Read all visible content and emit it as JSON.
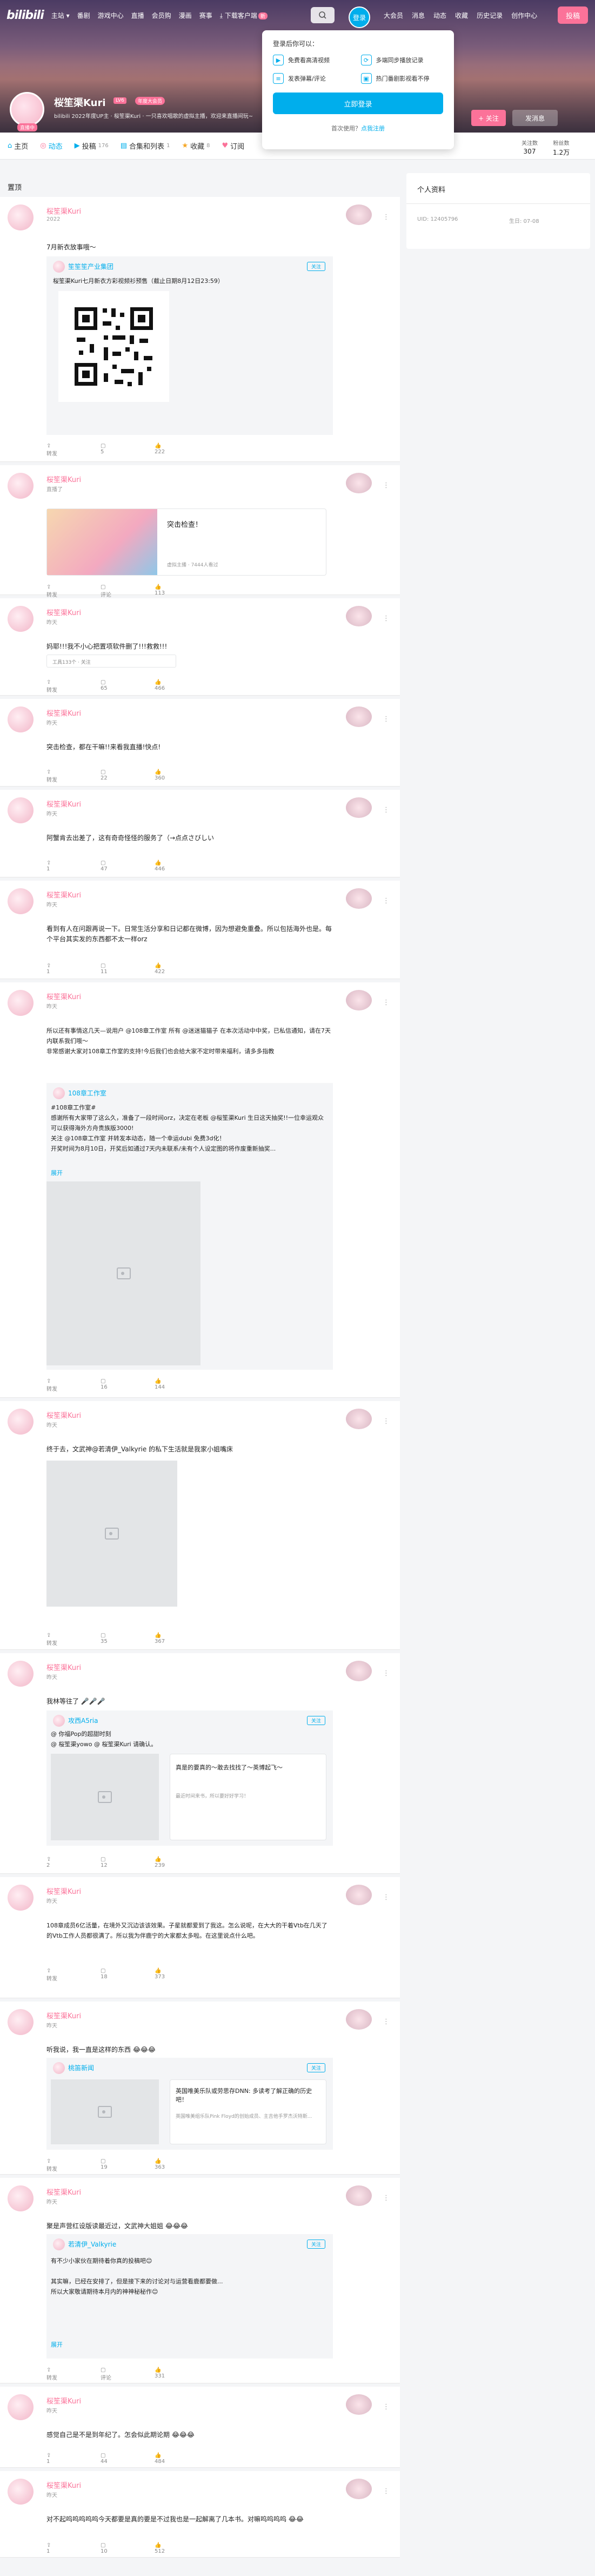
{
  "header": {
    "logo": "bilibili",
    "nav": [
      "主站",
      "番剧",
      "游戏中心",
      "直播",
      "会员购",
      "漫画",
      "赛事"
    ],
    "download": "下载客户端",
    "download_badge": "新",
    "login": "登录",
    "right_nav": [
      "大会员",
      "消息",
      "动态",
      "收藏",
      "历史记录",
      "创作中心"
    ],
    "post": "投稿"
  },
  "login_popup": {
    "title": "登录后你可以：",
    "items": [
      "免费看高清视频",
      "多端同步播放记录",
      "发表弹幕/评论",
      "热门番剧影视看不停"
    ],
    "button": "立即登录",
    "register_prefix": "首次使用？",
    "register_link": "点我注册"
  },
  "profile": {
    "name": "桜笙渠Kuri",
    "lv": "LV6",
    "vip": "年度大会员",
    "live_tag": "直播中",
    "sign": "bilibili 2022年度UP主 · 桜笙渠Kuri · 一只喜欢唱歌的虚拟主播，欢迎来直播间玩~",
    "follow": "+ 关注",
    "message": "发消息"
  },
  "tabs": [
    {
      "label": "主页",
      "icon": "home-icon",
      "count": ""
    },
    {
      "label": "动态",
      "icon": "feed-icon",
      "count": ""
    },
    {
      "label": "投稿",
      "icon": "upload-icon",
      "count": "176"
    },
    {
      "label": "合集和列表",
      "icon": "list-icon",
      "count": "1"
    },
    {
      "label": "收藏",
      "icon": "star-icon",
      "count": "8"
    },
    {
      "label": "订阅",
      "icon": "heart-icon",
      "count": ""
    }
  ],
  "stats": [
    {
      "label": "关注数",
      "value": "307"
    },
    {
      "label": "粉丝数",
      "value": "1.2万"
    }
  ],
  "section_label": "置顶",
  "sidebar": {
    "title": "个人资料",
    "uid": "UID: 12405796",
    "birthday": "生日: 07-08"
  },
  "posts": [
    {
      "name": "桜笙渠Kuri",
      "time": "2022",
      "text": "7月新衣放事哦～",
      "sub_name": "笙笙笙产业集团",
      "sub_text": "桜笙渠Kuri七月新衣方彩视频衫预售（截止日期8月12日23:59）",
      "follow": "关注",
      "actions": [
        "转发",
        "5",
        "222"
      ]
    },
    {
      "name": "桜笙渠Kuri",
      "time": "直播了",
      "live_title": "突击检查！",
      "live_meta": "虚拟主播 · 7444人看过",
      "actions": [
        "转发",
        "评论",
        "113"
      ]
    },
    {
      "name": "桜笙渠Kuri",
      "time": "昨天",
      "text": "妈耶!!!我不小心把置项软件删了!!!救救!!!",
      "sub_text": "工具133个 · 关注",
      "actions": [
        "转发",
        "65",
        "466"
      ]
    },
    {
      "name": "桜笙渠Kuri",
      "time": "昨天",
      "text": "突击检查，都在干嘛!!来看我直播!快点!",
      "actions": [
        "转发",
        "22",
        "360"
      ]
    },
    {
      "name": "桜笙渠Kuri",
      "time": "昨天",
      "text": "阿蟹肯去出差了，这有奇奇怪怪的服务了（→点点さびしい",
      "actions": [
        "1",
        "47",
        "446"
      ]
    },
    {
      "name": "桜笙渠Kuri",
      "time": "昨天",
      "text": "看到有人在问跟再说一下。日常生活分享和日记都在微博，因为想避免重叠。所以包括海外也是。每个平台其实发的东西都不太一样orz",
      "actions": [
        "1",
        "11",
        "422"
      ]
    },
    {
      "name": "桜笙渠Kuri",
      "time": "昨天",
      "text": "所以还有事情这几天—说用户 @108章工作室 所有 @迷迷猫猫子 在本次活动中中奖，已私信通知，请在7天内联系我们哦～\n非常感谢大家对108章工作室的支持!今后我们也会给大家不定时带来福利，请多多指教",
      "sub_name": "108章工作室",
      "sub_text": "#108章工作室#\n感谢所有大家带了这么久，准备了一段时间orz，决定在老板 @桜笙渠Kuri 生日这天抽奖!!一位幸运观众可以获得海外方舟贵族版3000!\n关注 @108章工作室 并转发本动态，随一个幸运dubi 免费3d化！\n开奖时间为8月10日，开奖后如通过7天内未联系/未有个人设定图的将作废重新抽奖...",
      "expand": "展开",
      "actions": [
        "转发",
        "16",
        "144"
      ]
    },
    {
      "name": "桜笙渠Kuri",
      "time": "昨天",
      "text": "终于去，文武神@若清伊_Valkyrie 的私下生活就是我家小姐嘴床",
      "actions": [
        "转发",
        "35",
        "367"
      ]
    },
    {
      "name": "桜笙渠Kuri",
      "time": "昨天",
      "text": "我林等往了 🎤🎤🎤",
      "sub_name": "攻西A5ria",
      "sub_text": "@ 你福Pop的超甜时刻\n@ 桜笙渠yowo @ 桜笙渠Kuri 请确认。",
      "link_title": "真是的要真的～敢去找找了～英博起飞～",
      "link_desc": "最近时间来书，所以要好好学习！",
      "follow": "关注",
      "actions": [
        "2",
        "12",
        "239"
      ]
    },
    {
      "name": "桜笙渠Kuri",
      "time": "昨天",
      "text": "108章成员6亿活量，在境外又沉边该该效果。子星就都爱到了我这。怎么说呢，在大大的干着Vtb在几天了的Vtb工作人员都很满了。所以我为伴鹿宁的大家都太多啦。在这里说点什么吧。",
      "actions": [
        "转发",
        "18",
        "373"
      ]
    },
    {
      "name": "桜笙渠Kuri",
      "time": "昨天",
      "text": "听我说，我一直是这样的东西 😂😂😂",
      "sub_name": "桃笛新闻",
      "link_title": "英国唯美乐队或劳思存DNN: 多读考了解正确的历史吧！",
      "link_desc": "英国唯美组乐队Pink Floyd的创始成员、主吉他手罗杰沃特斯...",
      "follow": "关注",
      "actions": [
        "转发",
        "19",
        "363"
      ]
    },
    {
      "name": "桜笙渠Kuri",
      "time": "昨天",
      "text": "聚是声营红设版读最近过，文武神大姐姐 😂😂😂",
      "sub_name": "若清伊_Valkyrie",
      "sub_text": "有不少小家伙在期待着你真的投稿吧😊\n\n其实嘛，已经在安排了，但是接下来的讨论对与运营看鹿都要做...\n所以大家敬请期待本月内的神神秘秘作😊",
      "expand": "展开",
      "follow": "关注",
      "actions": [
        "转发",
        "评论",
        "331"
      ]
    },
    {
      "name": "桜笙渠Kuri",
      "time": "昨天",
      "text": "感觉自己是不是到年纪了。怎会似此期论期 😂😂😂",
      "actions": [
        "1",
        "44",
        "484"
      ]
    },
    {
      "name": "桜笙渠Kuri",
      "time": "昨天",
      "text": "对不起呜呜呜呜呜今天都要是真的要是不过我也是一起解离了几本书。对嘛呜呜呜呜 😂😂",
      "actions": [
        "1",
        "10",
        "512"
      ]
    }
  ]
}
